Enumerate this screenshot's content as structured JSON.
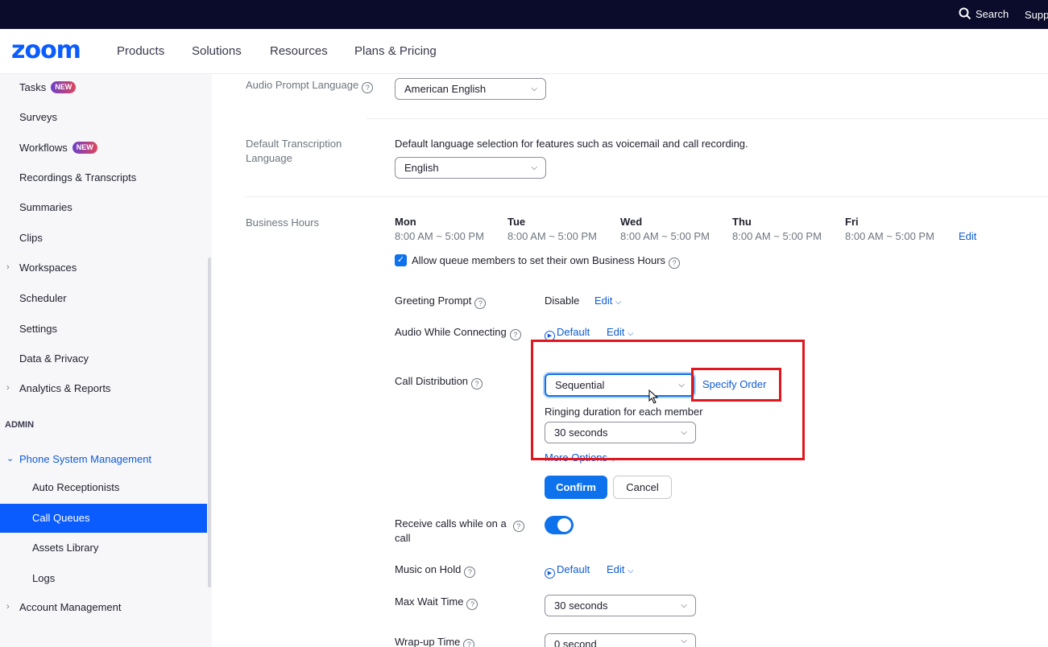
{
  "topbar": {
    "search_label": "Search",
    "support_label": "Supp"
  },
  "nav": {
    "logo": "zoom",
    "items": [
      "Products",
      "Solutions",
      "Resources",
      "Plans & Pricing"
    ]
  },
  "sidebar": {
    "badge": "NEW",
    "items": {
      "tasks": "Tasks",
      "surveys": "Surveys",
      "workflows": "Workflows",
      "recordings": "Recordings & Transcripts",
      "summaries": "Summaries",
      "clips": "Clips",
      "workspaces": "Workspaces",
      "scheduler": "Scheduler",
      "settings": "Settings",
      "data_privacy": "Data & Privacy",
      "analytics": "Analytics & Reports",
      "admin": "ADMIN",
      "phone_system": "Phone System Management",
      "auto_receptionists": "Auto Receptionists",
      "call_queues": "Call Queues",
      "assets_library": "Assets Library",
      "logs": "Logs",
      "account_management": "Account Management"
    }
  },
  "main": {
    "audio_prompt": {
      "label": "Audio Prompt Language",
      "value": "American English"
    },
    "transcription": {
      "label": "Default Transcription Language",
      "description": "Default language selection for features such as voicemail and call recording.",
      "value": "English"
    },
    "business_hours": {
      "label": "Business Hours",
      "days": [
        {
          "day": "Mon",
          "hours": "8:00 AM ~ 5:00 PM"
        },
        {
          "day": "Tue",
          "hours": "8:00 AM ~ 5:00 PM"
        },
        {
          "day": "Wed",
          "hours": "8:00 AM ~ 5:00 PM"
        },
        {
          "day": "Thu",
          "hours": "8:00 AM ~ 5:00 PM"
        },
        {
          "day": "Fri",
          "hours": "8:00 AM ~ 5:00 PM"
        }
      ],
      "edit": "Edit",
      "allow_own_hours": "Allow queue members to set their own Business Hours"
    },
    "greeting_prompt": {
      "label": "Greeting Prompt",
      "value": "Disable",
      "edit": "Edit"
    },
    "audio_connecting": {
      "label": "Audio While Connecting",
      "value": "Default",
      "edit": "Edit"
    },
    "call_distribution": {
      "label": "Call Distribution",
      "value": "Sequential",
      "specify_order": "Specify Order",
      "ringing_label": "Ringing duration for each member",
      "ringing_value": "30 seconds",
      "more_options": "More Options"
    },
    "confirm": "Confirm",
    "cancel": "Cancel",
    "receive_calls": {
      "label_line1": "Receive calls while on a",
      "label_line2": "call",
      "enabled": true
    },
    "music_on_hold": {
      "label": "Music on Hold",
      "value": "Default",
      "edit": "Edit"
    },
    "max_wait": {
      "label": "Max Wait Time",
      "value": "30 seconds"
    },
    "wrap_up": {
      "label": "Wrap-up Time",
      "value": "0 second"
    }
  },
  "colors": {
    "brand": "#0b5cff",
    "primary": "#0e72ed",
    "highlight": "#e1161e",
    "topbar": "#0b0b2b"
  }
}
